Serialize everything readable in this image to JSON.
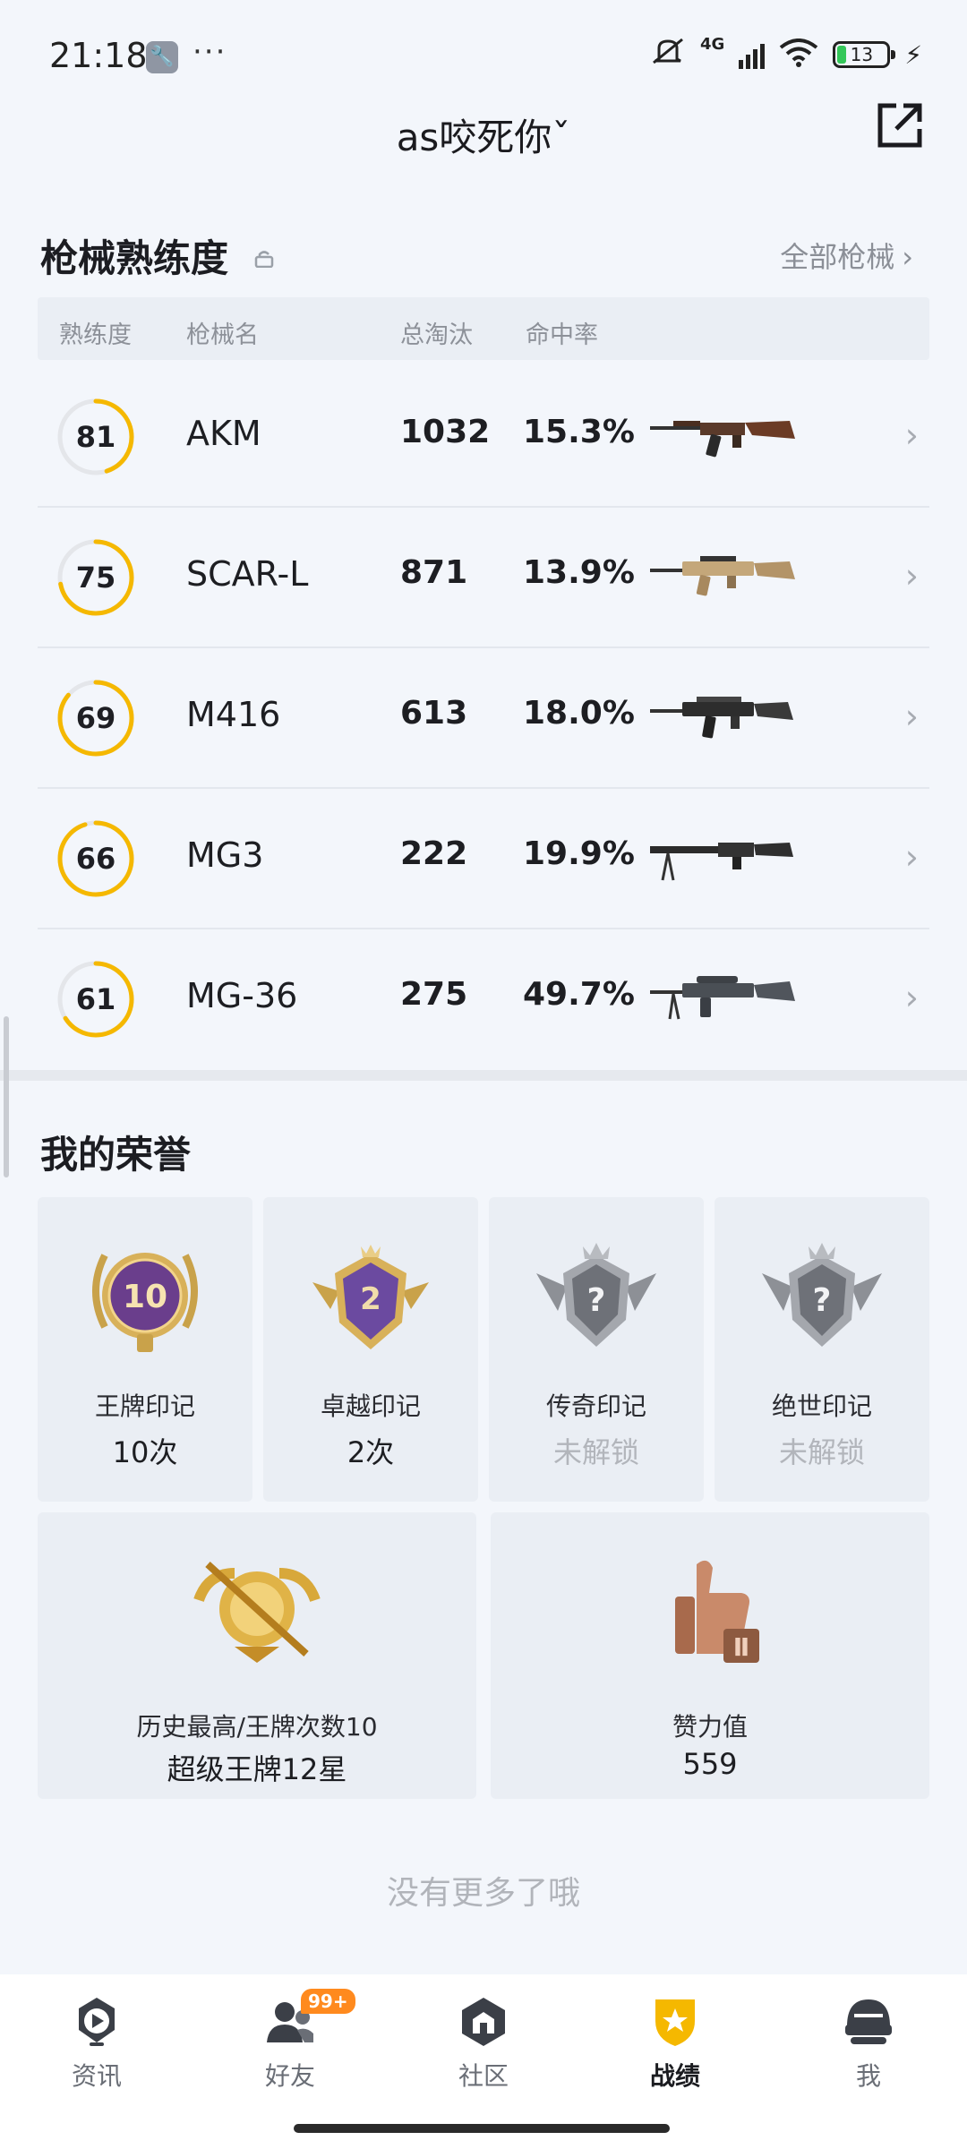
{
  "status_bar": {
    "time": "21:18",
    "more": "···",
    "network": "4G",
    "battery": "13"
  },
  "header": {
    "title": "as咬死你ˇ"
  },
  "weapons": {
    "title": "枪械熟练度",
    "all_label": "全部枪械",
    "columns": [
      "熟练度",
      "枪械名",
      "总淘汰",
      "命中率"
    ],
    "items": [
      {
        "level": "81",
        "name": "AKM",
        "kills": "1032",
        "rate": "15.3%",
        "progress": 0.45
      },
      {
        "level": "75",
        "name": "SCAR-L",
        "kills": "871",
        "rate": "13.9%",
        "progress": 0.72
      },
      {
        "level": "69",
        "name": "M416",
        "kills": "613",
        "rate": "18.0%",
        "progress": 0.86
      },
      {
        "level": "66",
        "name": "MG3",
        "kills": "222",
        "rate": "19.9%",
        "progress": 0.95
      },
      {
        "level": "61",
        "name": "MG-36",
        "kills": "275",
        "rate": "49.7%",
        "progress": 0.66
      }
    ]
  },
  "honor": {
    "title": "我的荣誉",
    "cards": [
      {
        "label": "王牌印记",
        "value": "10次",
        "emblem_text": "10"
      },
      {
        "label": "卓越印记",
        "value": "2次",
        "emblem_text": "2"
      },
      {
        "label": "传奇印记",
        "value": "未解锁",
        "emblem_text": "?"
      },
      {
        "label": "绝世印记",
        "value": "未解锁",
        "emblem_text": "?"
      }
    ],
    "history": {
      "label": "历史最高/王牌次数10",
      "value": "超级王牌12星"
    },
    "likes": {
      "label": "赞力值",
      "value": "559"
    }
  },
  "footer_text": "没有更多了哦",
  "nav": {
    "items": [
      {
        "label": "资讯",
        "icon": "news-icon"
      },
      {
        "label": "好友",
        "icon": "friends-icon",
        "badge": "99+"
      },
      {
        "label": "社区",
        "icon": "community-icon"
      },
      {
        "label": "战绩",
        "icon": "stats-icon"
      },
      {
        "label": "我",
        "icon": "profile-icon"
      }
    ],
    "active": "战绩"
  },
  "colors": {
    "accent": "#f5b800",
    "track": "#e4e6ea"
  }
}
